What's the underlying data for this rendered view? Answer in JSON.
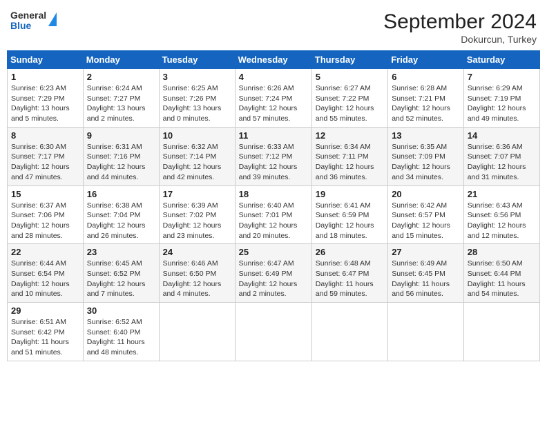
{
  "header": {
    "logo_general": "General",
    "logo_blue": "Blue",
    "month_title": "September 2024",
    "location": "Dokurcun, Turkey"
  },
  "weekdays": [
    "Sunday",
    "Monday",
    "Tuesday",
    "Wednesday",
    "Thursday",
    "Friday",
    "Saturday"
  ],
  "weeks": [
    [
      {
        "day": "1",
        "sunrise": "6:23 AM",
        "sunset": "7:29 PM",
        "daylight": "13 hours and 5 minutes."
      },
      {
        "day": "2",
        "sunrise": "6:24 AM",
        "sunset": "7:27 PM",
        "daylight": "13 hours and 2 minutes."
      },
      {
        "day": "3",
        "sunrise": "6:25 AM",
        "sunset": "7:26 PM",
        "daylight": "13 hours and 0 minutes."
      },
      {
        "day": "4",
        "sunrise": "6:26 AM",
        "sunset": "7:24 PM",
        "daylight": "12 hours and 57 minutes."
      },
      {
        "day": "5",
        "sunrise": "6:27 AM",
        "sunset": "7:22 PM",
        "daylight": "12 hours and 55 minutes."
      },
      {
        "day": "6",
        "sunrise": "6:28 AM",
        "sunset": "7:21 PM",
        "daylight": "12 hours and 52 minutes."
      },
      {
        "day": "7",
        "sunrise": "6:29 AM",
        "sunset": "7:19 PM",
        "daylight": "12 hours and 49 minutes."
      }
    ],
    [
      {
        "day": "8",
        "sunrise": "6:30 AM",
        "sunset": "7:17 PM",
        "daylight": "12 hours and 47 minutes."
      },
      {
        "day": "9",
        "sunrise": "6:31 AM",
        "sunset": "7:16 PM",
        "daylight": "12 hours and 44 minutes."
      },
      {
        "day": "10",
        "sunrise": "6:32 AM",
        "sunset": "7:14 PM",
        "daylight": "12 hours and 42 minutes."
      },
      {
        "day": "11",
        "sunrise": "6:33 AM",
        "sunset": "7:12 PM",
        "daylight": "12 hours and 39 minutes."
      },
      {
        "day": "12",
        "sunrise": "6:34 AM",
        "sunset": "7:11 PM",
        "daylight": "12 hours and 36 minutes."
      },
      {
        "day": "13",
        "sunrise": "6:35 AM",
        "sunset": "7:09 PM",
        "daylight": "12 hours and 34 minutes."
      },
      {
        "day": "14",
        "sunrise": "6:36 AM",
        "sunset": "7:07 PM",
        "daylight": "12 hours and 31 minutes."
      }
    ],
    [
      {
        "day": "15",
        "sunrise": "6:37 AM",
        "sunset": "7:06 PM",
        "daylight": "12 hours and 28 minutes."
      },
      {
        "day": "16",
        "sunrise": "6:38 AM",
        "sunset": "7:04 PM",
        "daylight": "12 hours and 26 minutes."
      },
      {
        "day": "17",
        "sunrise": "6:39 AM",
        "sunset": "7:02 PM",
        "daylight": "12 hours and 23 minutes."
      },
      {
        "day": "18",
        "sunrise": "6:40 AM",
        "sunset": "7:01 PM",
        "daylight": "12 hours and 20 minutes."
      },
      {
        "day": "19",
        "sunrise": "6:41 AM",
        "sunset": "6:59 PM",
        "daylight": "12 hours and 18 minutes."
      },
      {
        "day": "20",
        "sunrise": "6:42 AM",
        "sunset": "6:57 PM",
        "daylight": "12 hours and 15 minutes."
      },
      {
        "day": "21",
        "sunrise": "6:43 AM",
        "sunset": "6:56 PM",
        "daylight": "12 hours and 12 minutes."
      }
    ],
    [
      {
        "day": "22",
        "sunrise": "6:44 AM",
        "sunset": "6:54 PM",
        "daylight": "12 hours and 10 minutes."
      },
      {
        "day": "23",
        "sunrise": "6:45 AM",
        "sunset": "6:52 PM",
        "daylight": "12 hours and 7 minutes."
      },
      {
        "day": "24",
        "sunrise": "6:46 AM",
        "sunset": "6:50 PM",
        "daylight": "12 hours and 4 minutes."
      },
      {
        "day": "25",
        "sunrise": "6:47 AM",
        "sunset": "6:49 PM",
        "daylight": "12 hours and 2 minutes."
      },
      {
        "day": "26",
        "sunrise": "6:48 AM",
        "sunset": "6:47 PM",
        "daylight": "11 hours and 59 minutes."
      },
      {
        "day": "27",
        "sunrise": "6:49 AM",
        "sunset": "6:45 PM",
        "daylight": "11 hours and 56 minutes."
      },
      {
        "day": "28",
        "sunrise": "6:50 AM",
        "sunset": "6:44 PM",
        "daylight": "11 hours and 54 minutes."
      }
    ],
    [
      {
        "day": "29",
        "sunrise": "6:51 AM",
        "sunset": "6:42 PM",
        "daylight": "11 hours and 51 minutes."
      },
      {
        "day": "30",
        "sunrise": "6:52 AM",
        "sunset": "6:40 PM",
        "daylight": "11 hours and 48 minutes."
      },
      null,
      null,
      null,
      null,
      null
    ]
  ],
  "labels": {
    "sunrise": "Sunrise:",
    "sunset": "Sunset:",
    "daylight": "Daylight:"
  }
}
